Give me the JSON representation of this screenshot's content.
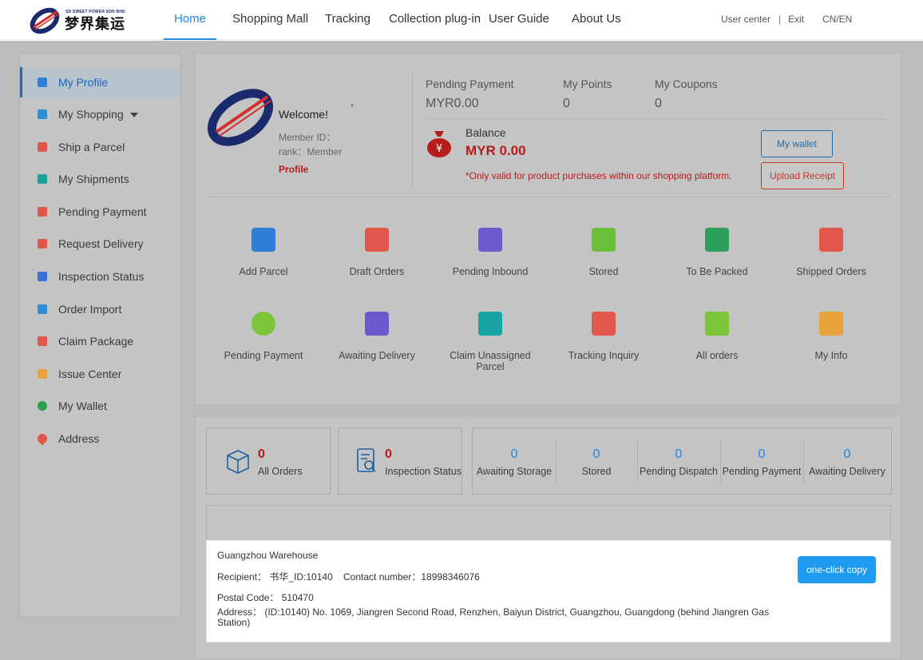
{
  "header": {
    "logo_en": "SD SWEET POWER SDN BHD",
    "logo_cn": "梦界集运",
    "nav": [
      "Home",
      "Shopping Mall",
      "Tracking",
      "Collection plug-in",
      "User Guide",
      "About Us"
    ],
    "user_center": "User center",
    "separator": "|",
    "exit": "Exit",
    "language": "CN/EN"
  },
  "sidebar": {
    "items": [
      {
        "label": "My Profile",
        "icon": "users-icon",
        "color": "#2f7fd6"
      },
      {
        "label": "My Shopping",
        "icon": "shopping-icon",
        "color": "#2f8fd6"
      },
      {
        "label": "Ship a Parcel",
        "icon": "parcel-icon",
        "color": "#e2574c"
      },
      {
        "label": "My Shipments",
        "icon": "cube-icon",
        "color": "#1aa39a"
      },
      {
        "label": "Pending Payment",
        "icon": "pen-icon",
        "color": "#e2574c"
      },
      {
        "label": "Request Delivery",
        "icon": "handshake-icon",
        "color": "#e2574c"
      },
      {
        "label": "Inspection Status",
        "icon": "inspection-icon",
        "color": "#3c6fd6"
      },
      {
        "label": "Order Import",
        "icon": "import-icon",
        "color": "#2f8fd6"
      },
      {
        "label": "Claim Package",
        "icon": "claim-icon",
        "color": "#e2574c"
      },
      {
        "label": "Issue Center",
        "icon": "calendar-icon",
        "color": "#e8a23a"
      },
      {
        "label": "My Wallet",
        "icon": "wallet-icon",
        "color": "#2aa04a"
      },
      {
        "label": "Address",
        "icon": "location-icon",
        "color": "#e2574c"
      }
    ]
  },
  "profile": {
    "welcome": "Welcome!",
    "comma": ",",
    "member_id": "Member ID：",
    "rank": "rank：Member",
    "profile_link": "Profile"
  },
  "summary": {
    "pending_payment_label": "Pending Payment",
    "pending_payment_value": "MYR0.00",
    "points_label": "My Points",
    "points_value": "0",
    "coupons_label": "My Coupons",
    "coupons_value": "0",
    "balance_label": "Balance",
    "balance_value": "MYR 0.00",
    "balance_note": "*Only valid for product purchases within our shopping platform.",
    "wallet_button": "My wallet",
    "upload_button": "Upload Receipt"
  },
  "quick_actions": {
    "row1": [
      {
        "label": "Add Parcel",
        "icon": "add-parcel-icon",
        "color": "#2f7fd6"
      },
      {
        "label": "Draft Orders",
        "icon": "draft-icon",
        "color": "#e2574c"
      },
      {
        "label": "Pending Inbound",
        "icon": "inbound-icon",
        "color": "#6a5acd"
      },
      {
        "label": "Stored",
        "icon": "stored-icon",
        "color": "#6abf3a"
      },
      {
        "label": "To Be Packed",
        "icon": "pack-icon",
        "color": "#2aa05a"
      },
      {
        "label": "Shipped Orders",
        "icon": "truck-icon",
        "color": "#e2574c"
      }
    ],
    "row2": [
      {
        "label": "Pending Payment",
        "icon": "yen-icon",
        "color": "#7cc43a"
      },
      {
        "label": "Awaiting Delivery",
        "icon": "delivery-icon",
        "color": "#6a5acd"
      },
      {
        "label": "Claim Unassigned Parcel",
        "icon": "claim-unassigned-icon",
        "color": "#1aa3a3"
      },
      {
        "label": "Tracking Inquiry",
        "icon": "tracking-icon",
        "color": "#e2574c"
      },
      {
        "label": "All orders",
        "icon": "list-icon",
        "color": "#7cc43a"
      },
      {
        "label": "My Info",
        "icon": "id-card-icon",
        "color": "#e8a23a"
      }
    ]
  },
  "stats": {
    "all_orders": {
      "value": "0",
      "label": "All Orders"
    },
    "inspection": {
      "value": "0",
      "label": "Inspection Status"
    },
    "group": [
      {
        "value": "0",
        "label": "Awaiting Storage"
      },
      {
        "value": "0",
        "label": "Stored"
      },
      {
        "value": "0",
        "label": "Pending Dispatch"
      },
      {
        "value": "0",
        "label": "Pending Payment"
      },
      {
        "value": "0",
        "label": "Awaiting Delivery"
      }
    ]
  },
  "warehouse": {
    "title": "Guangzhou Warehouse",
    "recipient": "Recipient： 书华_ID:10140",
    "contact": "Contact number：18998346076",
    "postal": "Postal Code： 510470",
    "address_line1": "Address： (ID:10140) No. 1069, Jiangren Second Road, Renzhen, Baiyun District, Guangzhou, Guangdong (behind Jiangren Gas",
    "address_line2": "Station)",
    "copy_button": "one-click copy"
  },
  "colors": {
    "accent": "#1e88e5",
    "overlay": "#bdbdbd",
    "red": "#c62828",
    "copy_button": "#1e9bf0"
  }
}
